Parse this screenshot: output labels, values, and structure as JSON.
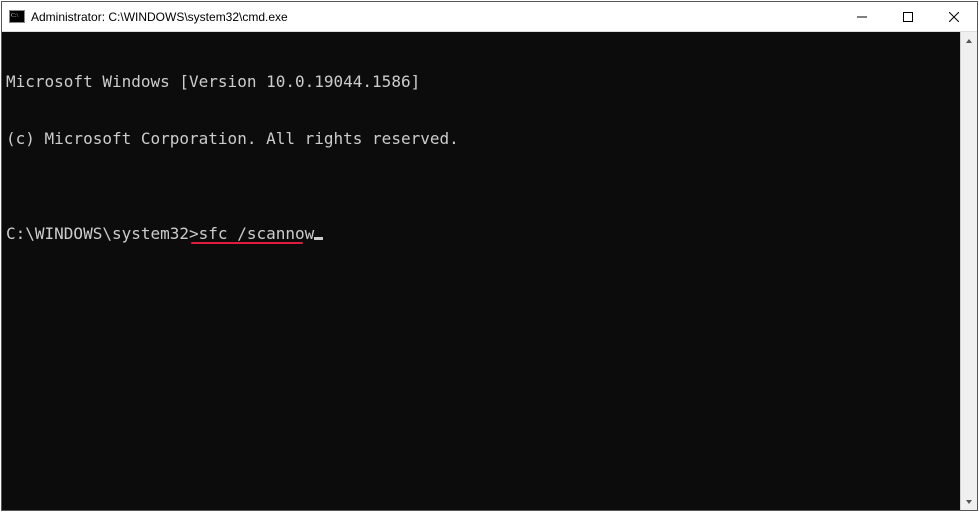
{
  "window": {
    "title": "Administrator: C:\\WINDOWS\\system32\\cmd.exe"
  },
  "terminal": {
    "line1": "Microsoft Windows [Version 10.0.19044.1586]",
    "line2": "(c) Microsoft Corporation. All rights reserved.",
    "blank": "",
    "prompt": "C:\\WINDOWS\\system32>",
    "command": "sfc /scannow"
  },
  "annotation": {
    "underline_color": "#e11b3c"
  }
}
